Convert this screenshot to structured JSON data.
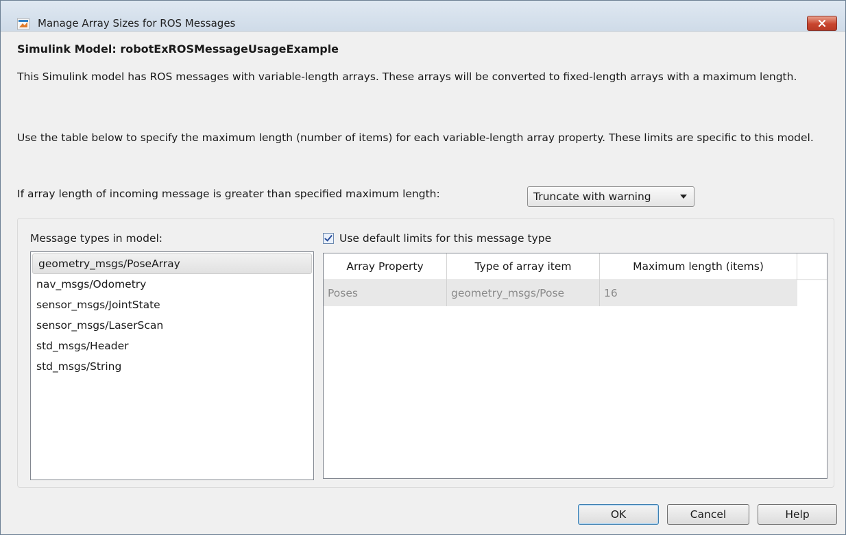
{
  "window": {
    "title": "Manage Array Sizes for ROS Messages",
    "close_icon": "close-icon"
  },
  "content": {
    "model_title": "Simulink Model: robotExROSMessageUsageExample",
    "description_1": "This Simulink model has ROS messages with variable-length arrays. These arrays will be converted to fixed-length arrays with a maximum length.",
    "description_2": "Use the table below to specify the maximum length (number of items) for each variable-length array property. These limits are specific to this model.",
    "policy": {
      "label": "If array length of incoming message is greater than specified maximum length:",
      "selected": "Truncate with warning"
    }
  },
  "message_types": {
    "label": "Message types in model:",
    "items": [
      "geometry_msgs/PoseArray",
      "nav_msgs/Odometry",
      "sensor_msgs/JointState",
      "sensor_msgs/LaserScan",
      "std_msgs/Header",
      "std_msgs/String"
    ],
    "selected_index": 0
  },
  "defaults": {
    "checkbox_label": "Use default limits for this message type",
    "checked": true
  },
  "table": {
    "columns": [
      "Array Property",
      "Type of array item",
      "Maximum length (items)"
    ],
    "rows": [
      [
        "Poses",
        "geometry_msgs/Pose",
        "16"
      ]
    ]
  },
  "buttons": {
    "ok": "OK",
    "cancel": "Cancel",
    "help": "Help"
  },
  "colors": {
    "close_button": "#c8462f",
    "titlebar": "#dfe8f2"
  }
}
